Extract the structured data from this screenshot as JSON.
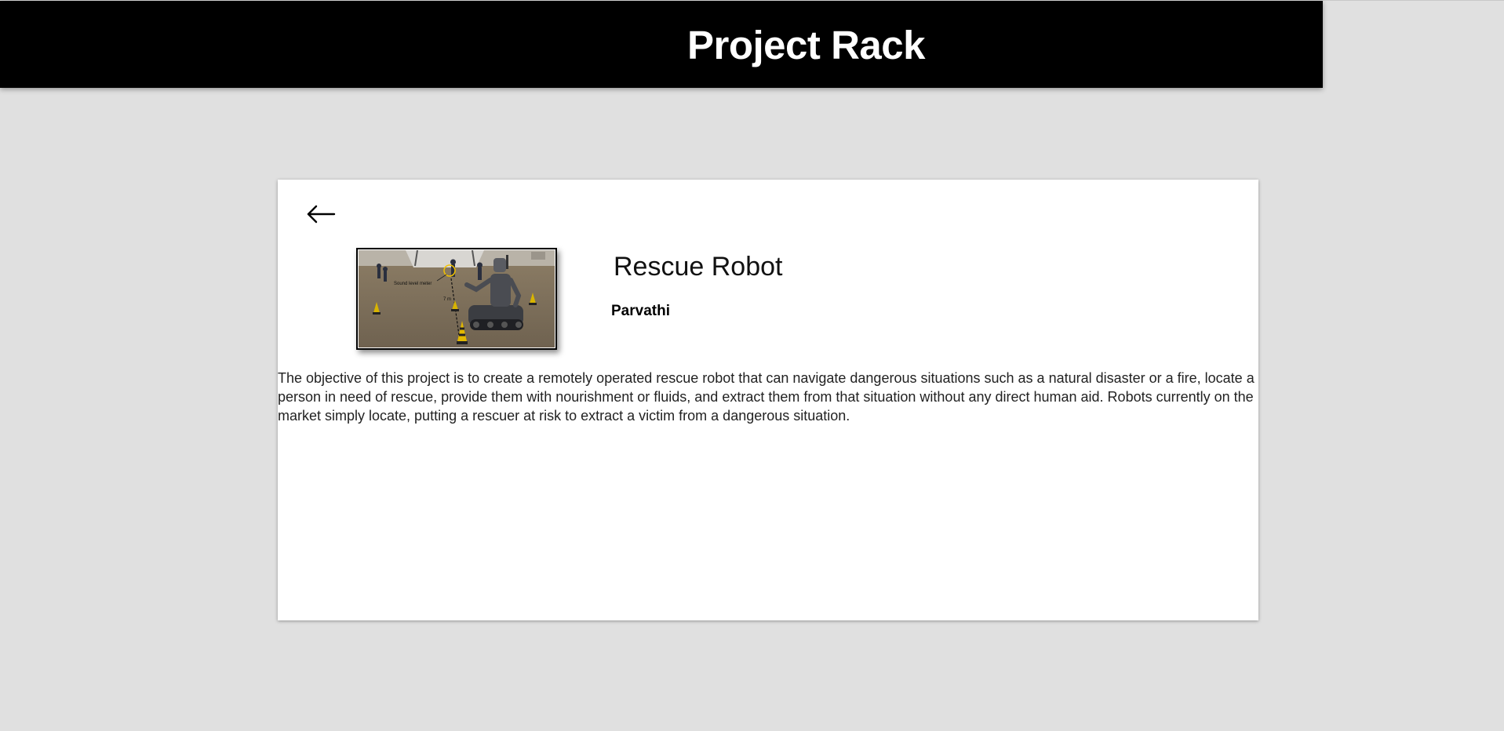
{
  "header": {
    "title": "Project Rack"
  },
  "project": {
    "back_icon": "arrow-left-icon",
    "image_alt": "Rescue robot on grass field with traffic cones",
    "image_annotation_sound": "Sound level meter",
    "image_annotation_distance": "7 m",
    "title": "Rescue Robot",
    "author": "Parvathi",
    "description": "The objective of this project is to create a remotely operated rescue robot that can navigate dangerous situations such as a natural disaster or a fire, locate a person in need of rescue, provide them with nourishment or fluids, and extract them from that situation without any direct human aid. Robots currently on the market simply locate, putting a rescuer at risk to extract a victim from a dangerous situation."
  },
  "colors": {
    "header_bg": "#000000",
    "page_bg": "#e0e0e0",
    "card_bg": "#ffffff",
    "header_text": "#ffffff"
  }
}
